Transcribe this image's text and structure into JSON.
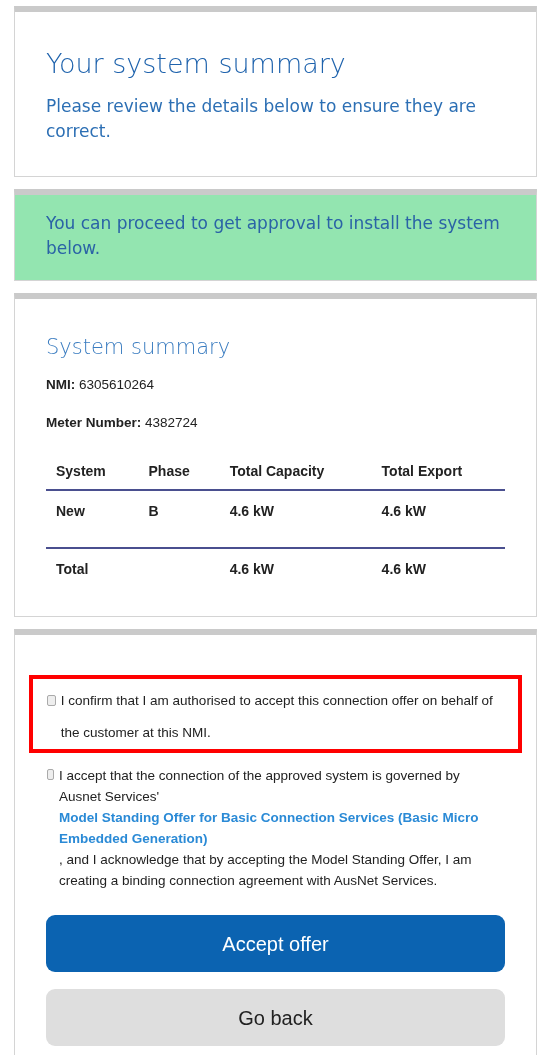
{
  "intro": {
    "title": "Your system summary",
    "text": "Please review the details below to ensure they are correct."
  },
  "notice": {
    "text": "You can proceed to get approval to install the system below."
  },
  "summary": {
    "title": "System summary",
    "fields": [
      {
        "label": "NMI:",
        "value": "6305610264"
      },
      {
        "label": "Meter Number:",
        "value": "4382724"
      }
    ],
    "table": {
      "columns": [
        "System",
        "Phase",
        "Total Capacity",
        "Total Export"
      ],
      "rows": [
        [
          "New",
          "B",
          "4.6 kW",
          "4.6 kW"
        ]
      ],
      "total": {
        "label": "Total",
        "capacity": "4.6 kW",
        "export": "4.6 kW"
      }
    }
  },
  "consents": [
    {
      "checked": false,
      "highlighted": true,
      "text": "I confirm that I am authorised to accept this connection offer on behalf of the customer at this NMI."
    },
    {
      "checked": false,
      "highlighted": false,
      "text": "I accept that the connection of the approved system is governed by Ausnet Services'",
      "link": "Model Standing Offer for Basic Connection Services (Basic Micro Embedded Generation)",
      "text_after": ", and I acknowledge that by accepting the Model Standing Offer, I am creating a binding connection agreement with AusNet Services."
    }
  ],
  "buttons": [
    {
      "label": "Accept offer",
      "kind": "primary"
    },
    {
      "label": "Go back",
      "kind": "secondary"
    }
  ]
}
